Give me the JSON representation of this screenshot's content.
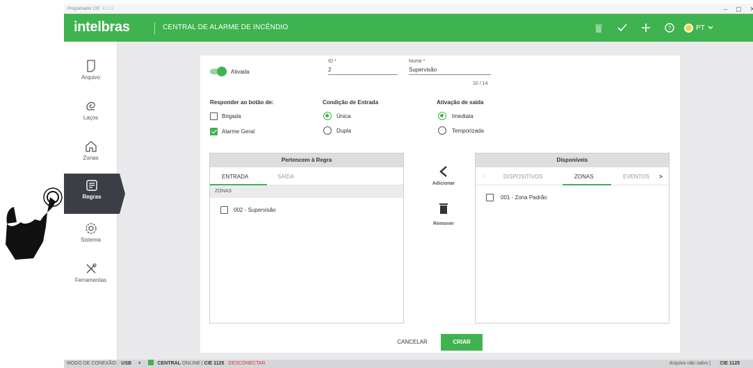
{
  "window": {
    "app_title": "Programador CIE",
    "version": "4.0.11",
    "controls": [
      "–",
      "▢",
      "✕"
    ]
  },
  "header": {
    "logo": "intelbras",
    "title": "CENTRAL DE ALARME DE INCÊNDIO",
    "lang": "PT"
  },
  "sidebar": {
    "items": [
      {
        "label": "Arquivo",
        "icon": "file-icon"
      },
      {
        "label": "Laços",
        "icon": "loop-icon"
      },
      {
        "label": "Zonas",
        "icon": "home-icon"
      },
      {
        "label": "Regras",
        "icon": "rules-icon",
        "active": true
      },
      {
        "label": "Sistema",
        "icon": "gear-icon"
      },
      {
        "label": "Ferramentas",
        "icon": "tools-icon"
      }
    ]
  },
  "form": {
    "toggle_label": "Ativada",
    "id_label": "ID *",
    "id_value": "2",
    "name_label": "Nome *",
    "name_value": "Supervisão",
    "name_counter": "10 / 14",
    "respond_title": "Responder ao botão de:",
    "respond_options": [
      {
        "label": "Brigada",
        "checked": false
      },
      {
        "label": "Alarme Geral",
        "checked": true
      }
    ],
    "entry_title": "Condição de Entrada",
    "entry_options": [
      {
        "label": "Única",
        "checked": true
      },
      {
        "label": "Dupla",
        "checked": false
      }
    ],
    "exit_title": "Ativação de saída",
    "exit_options": [
      {
        "label": "Imediata",
        "checked": true
      },
      {
        "label": "Temporizada",
        "checked": false
      }
    ]
  },
  "left_box": {
    "title": "Pertencem à Regra",
    "tabs": [
      "ENTRADA",
      "SAÍDA"
    ],
    "section": "ZONAS",
    "items": [
      "002 - Supervisão"
    ]
  },
  "middle": {
    "add_label": "Adicionar",
    "remove_label": "Remover"
  },
  "right_box": {
    "title": "Disponíveis",
    "tabs": [
      "DISPOSITIVOS",
      "ZONAS",
      "EVENTOS"
    ],
    "items": [
      "001 - Zona Padrão"
    ]
  },
  "actions": {
    "cancel": "CANCELAR",
    "create": "CRIAR"
  },
  "statusbar": {
    "conn_label": "MODO DE CONEXÃO:",
    "conn_value": "USB",
    "central": "CENTRAL",
    "online": "ONLINE |",
    "model": "CIE 1125",
    "disconnect": "DESCONECTAR",
    "file_status": "Arquivo não salvo |",
    "file_model": "CIE 1125"
  },
  "colors": {
    "brand": "#3fb34f",
    "sidebar_active": "#3b3e45",
    "background": "#e9e9eb"
  }
}
